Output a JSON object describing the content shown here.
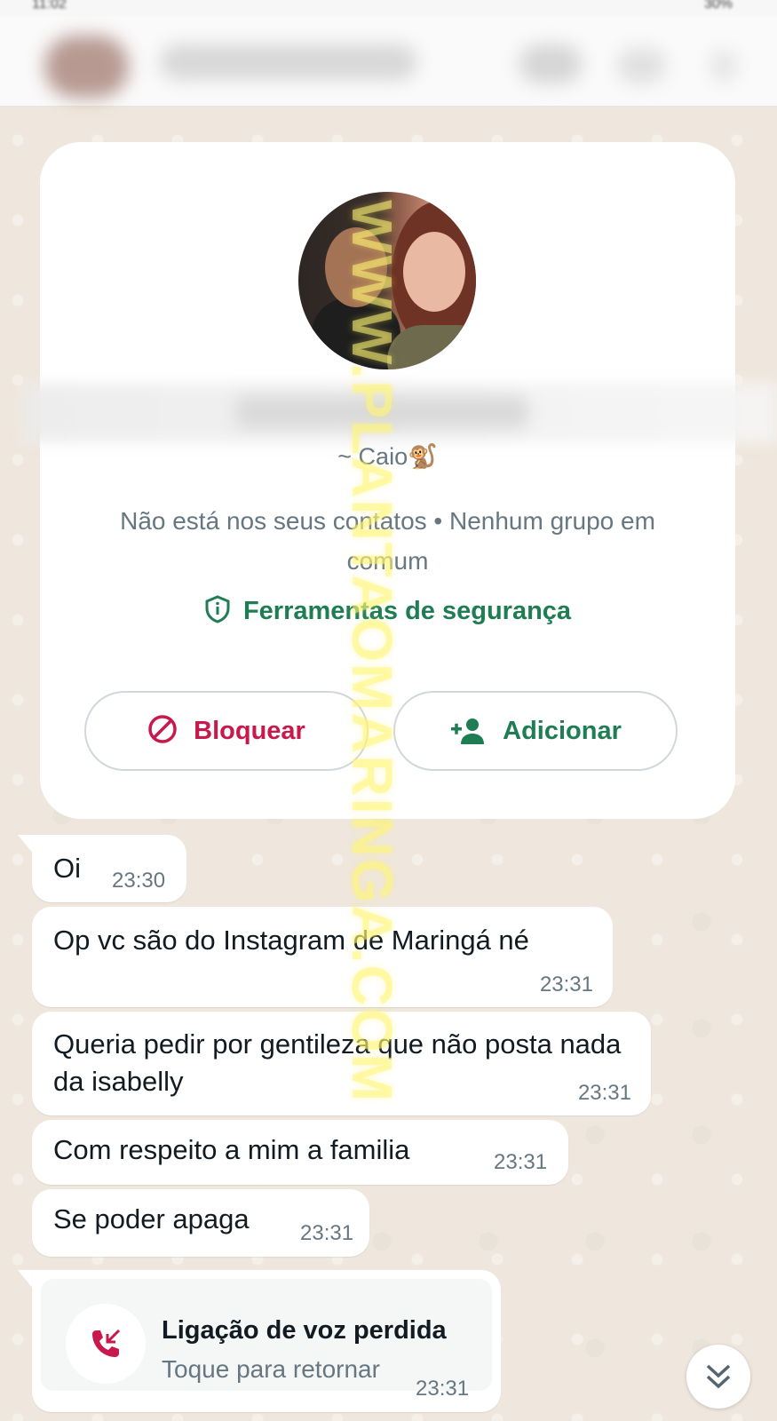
{
  "header": {
    "contact_name": "",
    "status_left": "11:02",
    "status_right": "30%"
  },
  "contact_card": {
    "push_name": "~ Caio🐒",
    "info_line": "Não está nos seus contatos • Nenhum grupo em comum",
    "safety_tools_label": "Ferramentas de segurança",
    "block_label": "Bloquear",
    "add_label": "Adicionar"
  },
  "messages": [
    {
      "text": "Oi",
      "time": "23:30"
    },
    {
      "text": "Op vc são do Instagram de Maringá né",
      "time": "23:31"
    },
    {
      "text": "Queria pedir por gentileza que não posta nada da isabelly",
      "time": "23:31"
    },
    {
      "text": "Com respeito a mim a familia",
      "time": "23:31"
    },
    {
      "text": "Se poder apaga",
      "time": "23:31"
    }
  ],
  "missed_call": {
    "title": "Ligação de voz perdida",
    "subtitle": "Toque para retornar",
    "time": "23:31"
  },
  "watermark": "WWW.PLANTAOMARINGA.COM",
  "colors": {
    "accent_green": "#1f7d53",
    "block_red": "#c8194c",
    "chat_bg": "#efe7dd",
    "bubble": "#ffffff"
  },
  "icons": {
    "shield": "shield-icon",
    "block": "block-icon",
    "add_person": "add-person-icon",
    "missed_call": "missed-call-icon",
    "scroll_down": "double-chevron-down-icon"
  }
}
